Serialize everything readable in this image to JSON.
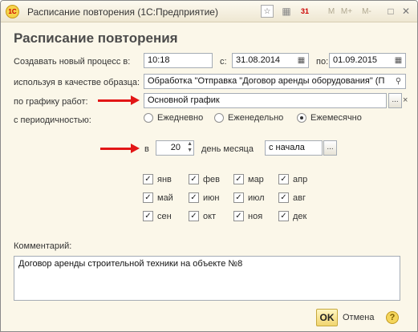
{
  "window": {
    "title": "Расписание повторения  (1С:Предприятие)",
    "app_logo_text": "1С",
    "toolbar_star": "☆",
    "toolbar_grid": "▦",
    "toolbar_calendar": "31",
    "toolbar_m": "M",
    "toolbar_mplus": "M+",
    "toolbar_mminus": "M-",
    "toolbar_restore": "□",
    "toolbar_close": "✕"
  },
  "heading": "Расписание повторения",
  "create": {
    "label": "Создавать новый процесс в:",
    "time": "10:18",
    "from_label": "с:",
    "from_date": "31.08.2014",
    "to_label": "по:",
    "to_date": "01.09.2015"
  },
  "sample": {
    "label": "используя в качестве образца:",
    "value": "Обработка \"Отправка \"Договор аренды оборудования\" (П"
  },
  "schedule": {
    "label": "по графику работ:",
    "value": "Основной график",
    "ellipsis": "...",
    "clear": "×"
  },
  "periodicity": {
    "label": "с периодичностью:",
    "options": [
      {
        "label": "Ежедневно",
        "selected": false
      },
      {
        "label": "Еженедельно",
        "selected": false
      },
      {
        "label": "Ежемесячно",
        "selected": true
      }
    ]
  },
  "day": {
    "prefix": "в",
    "value": "20",
    "suffix": "день месяца",
    "from": "с начала",
    "ellipsis": "..."
  },
  "months": [
    {
      "label": "янв",
      "checked": true
    },
    {
      "label": "фев",
      "checked": true
    },
    {
      "label": "мар",
      "checked": true
    },
    {
      "label": "апр",
      "checked": true
    },
    {
      "label": "май",
      "checked": true
    },
    {
      "label": "июн",
      "checked": true
    },
    {
      "label": "июл",
      "checked": true
    },
    {
      "label": "авг",
      "checked": true
    },
    {
      "label": "сен",
      "checked": true
    },
    {
      "label": "окт",
      "checked": true
    },
    {
      "label": "ноя",
      "checked": true
    },
    {
      "label": "дек",
      "checked": true
    }
  ],
  "comment": {
    "label": "Комментарий:",
    "value": "Договор аренды строительной техники на объекте №8"
  },
  "buttons": {
    "ok": "OK",
    "cancel": "Отмена",
    "help": "?"
  },
  "colors": {
    "arrow": "#e21616",
    "background": "#fbf7e9"
  }
}
